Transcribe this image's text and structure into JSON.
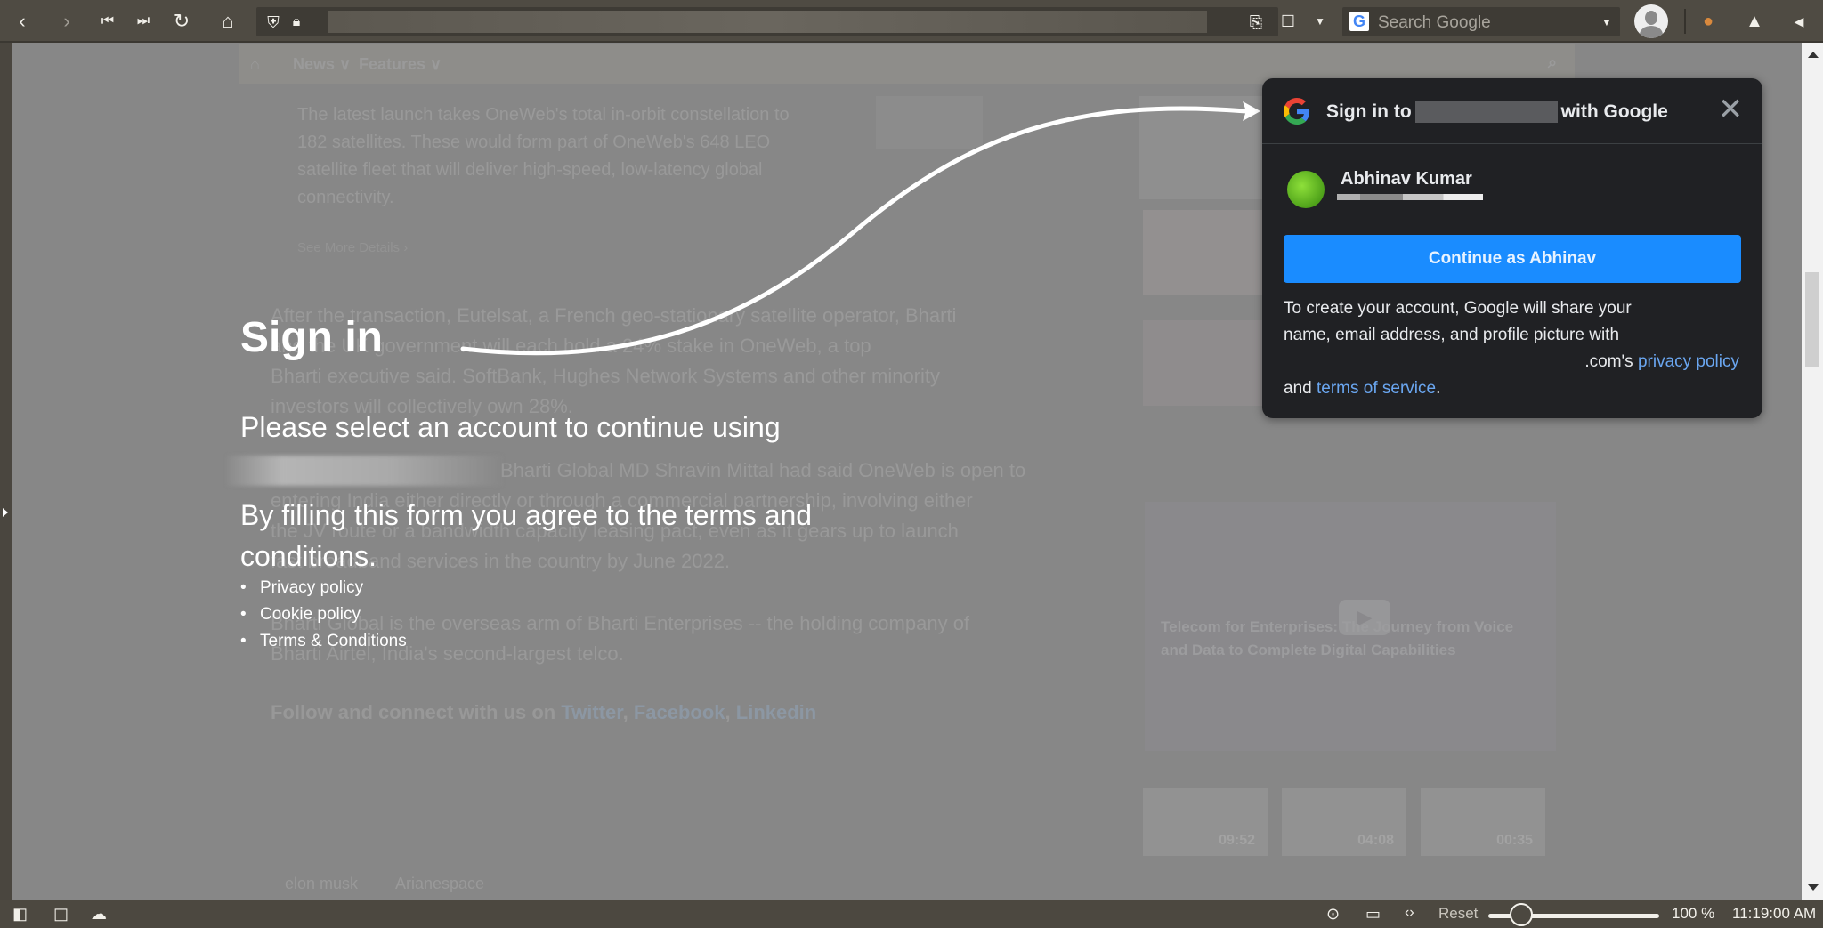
{
  "browser": {
    "search_placeholder": "Search Google",
    "zoom_percent": "100 %",
    "zoom_level": 1.0,
    "reset_label": "Reset",
    "clock": "11:19:00 AM"
  },
  "page": {
    "nav": [
      "News ∨",
      "Features ∨"
    ],
    "article_intro": [
      "The latest launch takes OneWeb's total in-orbit constellation to",
      "182 satellites. These would form part of OneWeb's 648 LEO",
      "satellite fleet that will deliver high-speed, low-latency global",
      "connectivity."
    ],
    "see_more": "See More Details ›",
    "article_body_1": [
      "After the transaction, Eutelsat, a French geo-stationary satellite operator, Bharti",
      "and the UK government will each hold a 24% stake in OneWeb, a top",
      "Bharti executive said. SoftBank, Hughes Network Systems and other minority",
      "investors will collectively own 28%."
    ],
    "article_body_2": [
      "Bharti Global MD Shravin Mittal had said OneWeb is open to",
      "entering India either directly or through a commercial partnership, involving either",
      "the JV route or a bandwidth capacity leasing pact, even as it gears up to launch",
      "fast broadband services in the country by June 2022."
    ],
    "article_body_3": [
      "Bharti Global is the overseas arm of Bharti Enterprises -- the holding company of",
      "Bharti Airtel, India's second-largest telco."
    ],
    "follow_text": "Follow and connect with us on",
    "follow_links": [
      "Twitter",
      "Facebook",
      "Linkedin"
    ],
    "video_title": [
      "Telecom for Enterprises: The Journey from Voice",
      "and Data to Complete Digital Capabilities"
    ],
    "video_durations": [
      "09:52",
      "04:08",
      "00:35"
    ],
    "tags": [
      "elon musk",
      "Arianespace"
    ]
  },
  "signin_overlay": {
    "title": "Sign in",
    "subtitle": "Please select an account to continue using",
    "terms_text": "By filling this form you agree to the terms and conditions.",
    "links": [
      "Privacy policy",
      "Cookie policy",
      "Terms & Conditions"
    ]
  },
  "google_popup": {
    "title_prefix": "Sign in to",
    "title_suffix": "with Google",
    "account_name": "Abhinav Kumar",
    "continue_label": "Continue as Abhinav",
    "info_line1": "To create your account, Google will share your",
    "info_line2": "name, email address, and profile picture with",
    "info_line3_prefix": ".com's",
    "privacy_link": "privacy policy",
    "info_line4_prefix": "and",
    "terms_link": "terms of service",
    "info_line4_suffix": ".",
    "accent_color": "#1a8cff"
  }
}
